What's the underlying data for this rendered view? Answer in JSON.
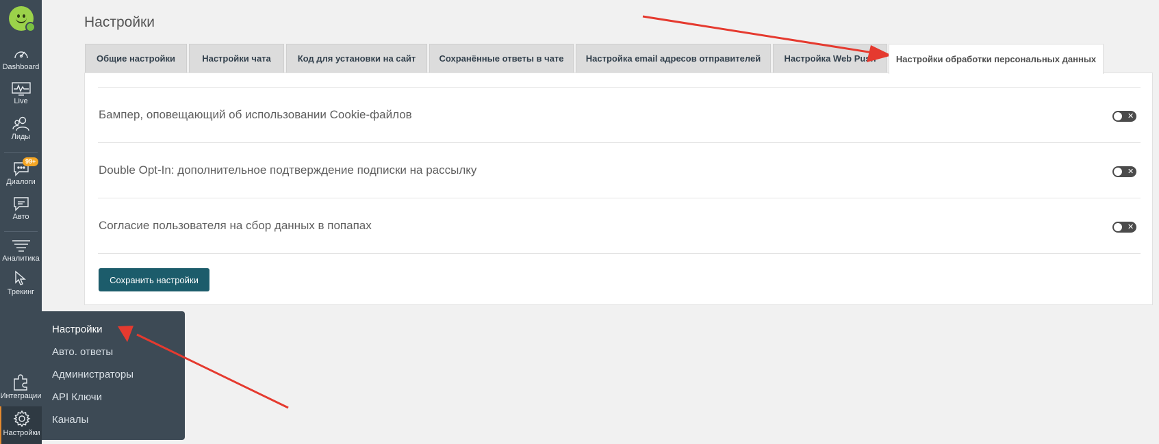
{
  "sidebar": {
    "items": [
      {
        "label": "Dashboard",
        "icon": "gauge-icon"
      },
      {
        "label": "Live",
        "icon": "pulse-monitor-icon"
      },
      {
        "label": "Лиды",
        "icon": "users-icon"
      },
      {
        "label": "Диалоги",
        "icon": "chat-bubble-icon",
        "badge": "99+"
      },
      {
        "label": "Авто",
        "icon": "auto-chat-icon"
      },
      {
        "label": "Аналитика",
        "icon": "funnel-icon"
      },
      {
        "label": "Трекинг",
        "icon": "cursor-icon"
      },
      {
        "label": "Интеграции",
        "icon": "puzzle-icon"
      },
      {
        "label": "Настройки",
        "icon": "gear-icon"
      }
    ]
  },
  "submenu": {
    "items": [
      "Настройки",
      "Авто. ответы",
      "Администраторы",
      "API Ключи",
      "Каналы"
    ]
  },
  "page": {
    "title": "Настройки"
  },
  "tabs": [
    "Общие настройки",
    "Настройки чата",
    "Код для установки на сайт",
    "Сохранённые ответы в чате",
    "Настройка email адресов отправителей",
    "Настройка Web Push",
    "Настройки обработки персональных данных"
  ],
  "settings": [
    {
      "label": "Бампер, оповещающий об использовании Cookie-файлов",
      "enabled": false,
      "off_symbol": "✕"
    },
    {
      "label": "Double Opt-In: дополнительное подтверждение подписки на рассылку",
      "enabled": false,
      "off_symbol": "✕"
    },
    {
      "label": "Согласие пользователя на сбор данных в попапах",
      "enabled": false,
      "off_symbol": "✕"
    }
  ],
  "save_button": "Сохранить настройки",
  "colors": {
    "sidebar": "#3d4a55",
    "primary_button": "#1c5c6b",
    "annotation_arrow": "#e53a2f",
    "badge": "#f5a623"
  }
}
